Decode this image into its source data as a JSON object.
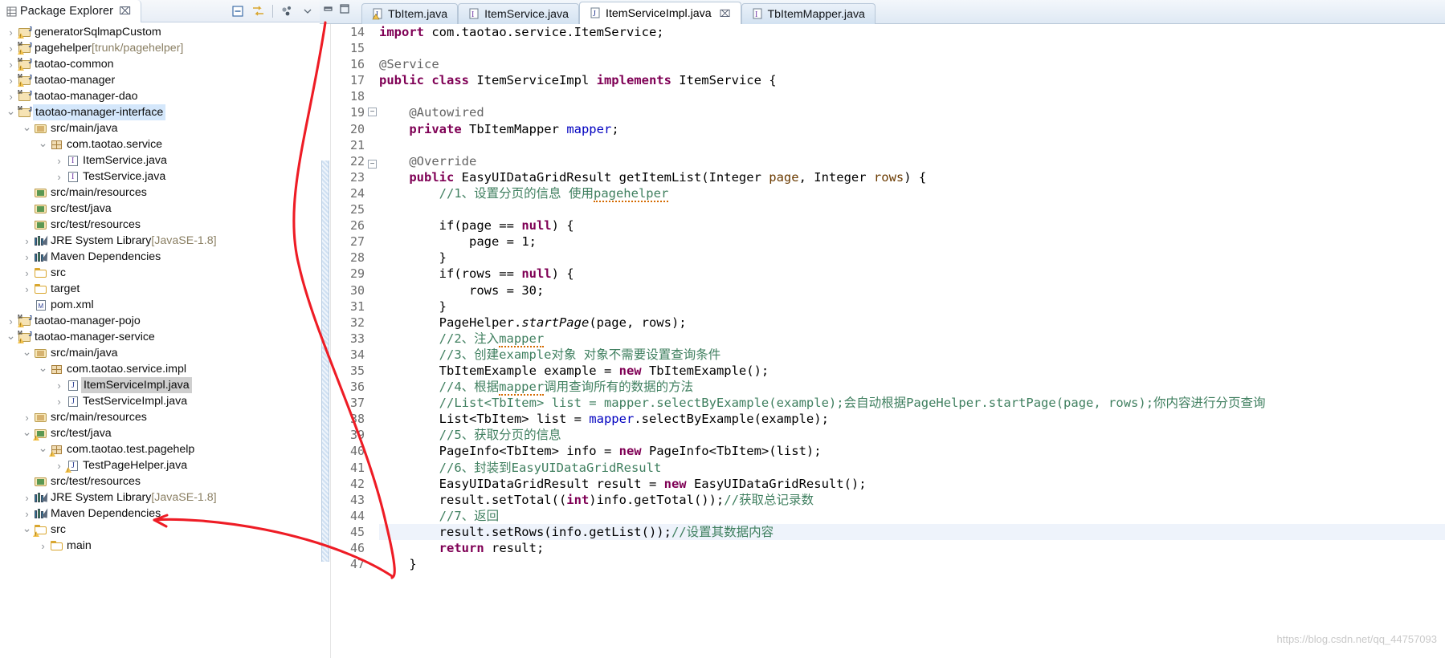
{
  "explorer": {
    "title": "Package Explorer",
    "close_label": "⌧",
    "toolbar": [
      {
        "name": "collapse-all-icon",
        "label": ""
      },
      {
        "name": "link-with-editor-icon",
        "label": ""
      },
      {
        "name": "view-menu-icon",
        "label": ""
      },
      {
        "name": "view-chevron-icon",
        "label": "▽"
      }
    ],
    "tree": [
      {
        "depth": 0,
        "arrow": "collapsed",
        "icon": "project-warn",
        "label": "generatorSqlmapCustom",
        "suffix": "",
        "sel": ""
      },
      {
        "depth": 0,
        "arrow": "collapsed",
        "icon": "project-maven-warn",
        "label": "pagehelper",
        "suffix": " [trunk/pagehelper]",
        "sel": ""
      },
      {
        "depth": 0,
        "arrow": "collapsed",
        "icon": "project-maven-warn",
        "label": "taotao-common",
        "suffix": "",
        "sel": ""
      },
      {
        "depth": 0,
        "arrow": "collapsed",
        "icon": "project-maven-warn",
        "label": "taotao-manager",
        "suffix": "",
        "sel": ""
      },
      {
        "depth": 0,
        "arrow": "collapsed",
        "icon": "project-maven",
        "label": "taotao-manager-dao",
        "suffix": "",
        "sel": ""
      },
      {
        "depth": 0,
        "arrow": "expanded",
        "icon": "project-maven",
        "label": "taotao-manager-interface",
        "suffix": "",
        "sel": "blue"
      },
      {
        "depth": 1,
        "arrow": "expanded",
        "icon": "srcfolder",
        "label": "src/main/java",
        "suffix": "",
        "sel": ""
      },
      {
        "depth": 2,
        "arrow": "expanded",
        "icon": "package",
        "label": "com.taotao.service",
        "suffix": "",
        "sel": ""
      },
      {
        "depth": 3,
        "arrow": "collapsed",
        "icon": "java-interface",
        "label": "ItemService.java",
        "suffix": "",
        "sel": ""
      },
      {
        "depth": 3,
        "arrow": "collapsed",
        "icon": "java-interface",
        "label": "TestService.java",
        "suffix": "",
        "sel": ""
      },
      {
        "depth": 1,
        "arrow": "none",
        "icon": "srcfolder-green",
        "label": "src/main/resources",
        "suffix": "",
        "sel": ""
      },
      {
        "depth": 1,
        "arrow": "none",
        "icon": "srcfolder-green",
        "label": "src/test/java",
        "suffix": "",
        "sel": ""
      },
      {
        "depth": 1,
        "arrow": "none",
        "icon": "srcfolder-green",
        "label": "src/test/resources",
        "suffix": "",
        "sel": ""
      },
      {
        "depth": 1,
        "arrow": "collapsed",
        "icon": "library",
        "label": "JRE System Library",
        "suffix": " [JavaSE-1.8]",
        "sel": ""
      },
      {
        "depth": 1,
        "arrow": "collapsed",
        "icon": "library",
        "label": "Maven Dependencies",
        "suffix": "",
        "sel": ""
      },
      {
        "depth": 1,
        "arrow": "collapsed",
        "icon": "folder",
        "label": "src",
        "suffix": "",
        "sel": ""
      },
      {
        "depth": 1,
        "arrow": "collapsed",
        "icon": "folder",
        "label": "target",
        "suffix": "",
        "sel": ""
      },
      {
        "depth": 1,
        "arrow": "none",
        "icon": "xmlfile",
        "label": "pom.xml",
        "suffix": "",
        "sel": ""
      },
      {
        "depth": 0,
        "arrow": "collapsed",
        "icon": "project-maven-warn",
        "label": "taotao-manager-pojo",
        "suffix": "",
        "sel": ""
      },
      {
        "depth": 0,
        "arrow": "expanded",
        "icon": "project-maven-warn",
        "label": "taotao-manager-service",
        "suffix": "",
        "sel": ""
      },
      {
        "depth": 1,
        "arrow": "expanded",
        "icon": "srcfolder",
        "label": "src/main/java",
        "suffix": "",
        "sel": ""
      },
      {
        "depth": 2,
        "arrow": "expanded",
        "icon": "package",
        "label": "com.taotao.service.impl",
        "suffix": "",
        "sel": ""
      },
      {
        "depth": 3,
        "arrow": "collapsed",
        "icon": "java",
        "label": "ItemServiceImpl.java",
        "suffix": "",
        "sel": "gray"
      },
      {
        "depth": 3,
        "arrow": "collapsed",
        "icon": "java",
        "label": "TestServiceImpl.java",
        "suffix": "",
        "sel": ""
      },
      {
        "depth": 1,
        "arrow": "collapsed",
        "icon": "srcfolder",
        "label": "src/main/resources",
        "suffix": "",
        "sel": ""
      },
      {
        "depth": 1,
        "arrow": "expanded",
        "icon": "srcfolder-green-warn",
        "label": "src/test/java",
        "suffix": "",
        "sel": ""
      },
      {
        "depth": 2,
        "arrow": "expanded",
        "icon": "package-warn",
        "label": "com.taotao.test.pagehelp",
        "suffix": "",
        "sel": ""
      },
      {
        "depth": 3,
        "arrow": "collapsed",
        "icon": "java-warn",
        "label": "TestPageHelper.java",
        "suffix": "",
        "sel": ""
      },
      {
        "depth": 1,
        "arrow": "none",
        "icon": "srcfolder-green",
        "label": "src/test/resources",
        "suffix": "",
        "sel": ""
      },
      {
        "depth": 1,
        "arrow": "collapsed",
        "icon": "library",
        "label": "JRE System Library",
        "suffix": " [JavaSE-1.8]",
        "sel": ""
      },
      {
        "depth": 1,
        "arrow": "collapsed",
        "icon": "library",
        "label": "Maven Dependencies",
        "suffix": "",
        "sel": ""
      },
      {
        "depth": 1,
        "arrow": "expanded",
        "icon": "folder-warn",
        "label": "src",
        "suffix": "",
        "sel": ""
      },
      {
        "depth": 2,
        "arrow": "collapsed",
        "icon": "folder",
        "label": "main",
        "suffix": "",
        "sel": ""
      }
    ]
  },
  "editor": {
    "window_buttons": [
      "minimize-icon",
      "maximize-icon"
    ],
    "tabs": [
      {
        "label": "TbItem.java",
        "active": false,
        "icon": "java-warn-icon",
        "closable": false
      },
      {
        "label": "ItemService.java",
        "active": false,
        "icon": "java-interface-icon",
        "closable": false
      },
      {
        "label": "ItemServiceImpl.java",
        "active": true,
        "icon": "java-icon",
        "closable": true,
        "close_label": "⌧"
      },
      {
        "label": "TbItemMapper.java",
        "active": false,
        "icon": "java-interface-icon",
        "closable": false
      }
    ],
    "first_line_number": 14,
    "highlight_line": 45,
    "fold_lines": [
      19,
      22
    ],
    "breakpoint_line": 23,
    "lines": [
      {
        "n": 14,
        "tokens": [
          [
            "kw",
            "import "
          ],
          [
            "typ",
            "com.taotao.service.ItemService;"
          ]
        ]
      },
      {
        "n": 15,
        "tokens": [
          [
            "typ",
            ""
          ]
        ]
      },
      {
        "n": 16,
        "tokens": [
          [
            "ann",
            "@Service"
          ]
        ]
      },
      {
        "n": 17,
        "tokens": [
          [
            "kw",
            "public "
          ],
          [
            "kw",
            "class "
          ],
          [
            "typ",
            "ItemServiceImpl "
          ],
          [
            "kw",
            "implements "
          ],
          [
            "typ",
            "ItemService {"
          ]
        ]
      },
      {
        "n": 18,
        "tokens": [
          [
            "typ",
            ""
          ]
        ]
      },
      {
        "n": 19,
        "tokens": [
          [
            "ann",
            "    @Autowired"
          ]
        ]
      },
      {
        "n": 20,
        "tokens": [
          [
            "kw",
            "    private "
          ],
          [
            "typ",
            "TbItemMapper "
          ],
          [
            "fld",
            "mapper"
          ],
          [
            "typ",
            ";"
          ]
        ]
      },
      {
        "n": 21,
        "tokens": [
          [
            "typ",
            ""
          ]
        ]
      },
      {
        "n": 22,
        "tokens": [
          [
            "ann",
            "    @Override"
          ]
        ]
      },
      {
        "n": 23,
        "tokens": [
          [
            "kw",
            "    public "
          ],
          [
            "typ",
            "EasyUIDataGridResult getItemList(Integer "
          ],
          [
            "prm",
            "page"
          ],
          [
            "typ",
            ", Integer "
          ],
          [
            "prm",
            "rows"
          ],
          [
            "typ",
            ") {"
          ]
        ]
      },
      {
        "n": 24,
        "tokens": [
          [
            "cmt",
            "        //1、设置分页的信息 使用"
          ],
          [
            "cmtspell",
            "pagehelper"
          ]
        ]
      },
      {
        "n": 25,
        "tokens": [
          [
            "typ",
            ""
          ]
        ]
      },
      {
        "n": 26,
        "tokens": [
          [
            "typ",
            "        if(page == "
          ],
          [
            "kw",
            "null"
          ],
          [
            "typ",
            ") {"
          ]
        ]
      },
      {
        "n": 27,
        "tokens": [
          [
            "typ",
            "            page = "
          ],
          [
            "num",
            "1"
          ],
          [
            "typ",
            ";"
          ]
        ]
      },
      {
        "n": 28,
        "tokens": [
          [
            "typ",
            "        }"
          ]
        ]
      },
      {
        "n": 29,
        "tokens": [
          [
            "typ",
            "        if(rows == "
          ],
          [
            "kw",
            "null"
          ],
          [
            "typ",
            ") {"
          ]
        ]
      },
      {
        "n": 30,
        "tokens": [
          [
            "typ",
            "            rows = "
          ],
          [
            "num",
            "30"
          ],
          [
            "typ",
            ";"
          ]
        ]
      },
      {
        "n": 31,
        "tokens": [
          [
            "typ",
            "        }"
          ]
        ]
      },
      {
        "n": 32,
        "tokens": [
          [
            "typ",
            "        PageHelper."
          ],
          [
            "sta",
            "startPage"
          ],
          [
            "typ",
            "(page, rows);"
          ]
        ]
      },
      {
        "n": 33,
        "tokens": [
          [
            "cmt",
            "        //2、注入"
          ],
          [
            "cmtspell",
            "mapper"
          ]
        ]
      },
      {
        "n": 34,
        "tokens": [
          [
            "cmt",
            "        //3、创建example对象 对象不需要设置查询条件"
          ]
        ]
      },
      {
        "n": 35,
        "tokens": [
          [
            "typ",
            "        TbItemExample example = "
          ],
          [
            "kw",
            "new "
          ],
          [
            "typ",
            "TbItemExample();"
          ]
        ]
      },
      {
        "n": 36,
        "tokens": [
          [
            "cmt",
            "        //4、根据"
          ],
          [
            "cmtspell",
            "mapper"
          ],
          [
            "cmt",
            "调用查询所有的数据的方法"
          ]
        ]
      },
      {
        "n": 37,
        "tokens": [
          [
            "cmt",
            "        //List<TbItem> list = mapper.selectByExample(example);会自动根据PageHelper.startPage(page, rows);你内容进行分页查询"
          ]
        ]
      },
      {
        "n": 38,
        "tokens": [
          [
            "typ",
            "        List<TbItem> list = "
          ],
          [
            "fld",
            "mapper"
          ],
          [
            "typ",
            ".selectByExample(example);"
          ]
        ]
      },
      {
        "n": 39,
        "tokens": [
          [
            "cmt",
            "        //5、获取分页的信息"
          ]
        ]
      },
      {
        "n": 40,
        "tokens": [
          [
            "typ",
            "        PageInfo<TbItem> info = "
          ],
          [
            "kw",
            "new "
          ],
          [
            "typ",
            "PageInfo<TbItem>(list);"
          ]
        ]
      },
      {
        "n": 41,
        "tokens": [
          [
            "cmt",
            "        //6、封装到EasyUIDataGridResult"
          ]
        ]
      },
      {
        "n": 42,
        "tokens": [
          [
            "typ",
            "        EasyUIDataGridResult result = "
          ],
          [
            "kw",
            "new "
          ],
          [
            "typ",
            "EasyUIDataGridResult();"
          ]
        ]
      },
      {
        "n": 43,
        "tokens": [
          [
            "typ",
            "        result.setTotal(("
          ],
          [
            "kw",
            "int"
          ],
          [
            "typ",
            ")info.getTotal());"
          ],
          [
            "cmt",
            "//获取总记录数"
          ]
        ]
      },
      {
        "n": 44,
        "tokens": [
          [
            "cmt",
            "        //7、返回"
          ]
        ]
      },
      {
        "n": 45,
        "tokens": [
          [
            "typ",
            "        result.setRows(info.getList());"
          ],
          [
            "cmt",
            "//设置其数据内容"
          ]
        ]
      },
      {
        "n": 46,
        "tokens": [
          [
            "kw",
            "        return "
          ],
          [
            "typ",
            "result;"
          ]
        ]
      },
      {
        "n": 47,
        "tokens": [
          [
            "typ",
            "    }"
          ]
        ]
      }
    ]
  },
  "annotation": {
    "name": "red-arrow-annotation",
    "color": "#ee1c25"
  },
  "watermark": {
    "text": "https://blog.csdn.net/qq_44757093"
  },
  "colors": {
    "selection_blue": "#d4e7fb",
    "selection_gray": "#cfcfcf",
    "keyword": "#7f0055",
    "comment": "#3f7f5f",
    "field": "#0000c0",
    "annotation_red": "#ee1c25",
    "tab_active": "#ffffff"
  }
}
